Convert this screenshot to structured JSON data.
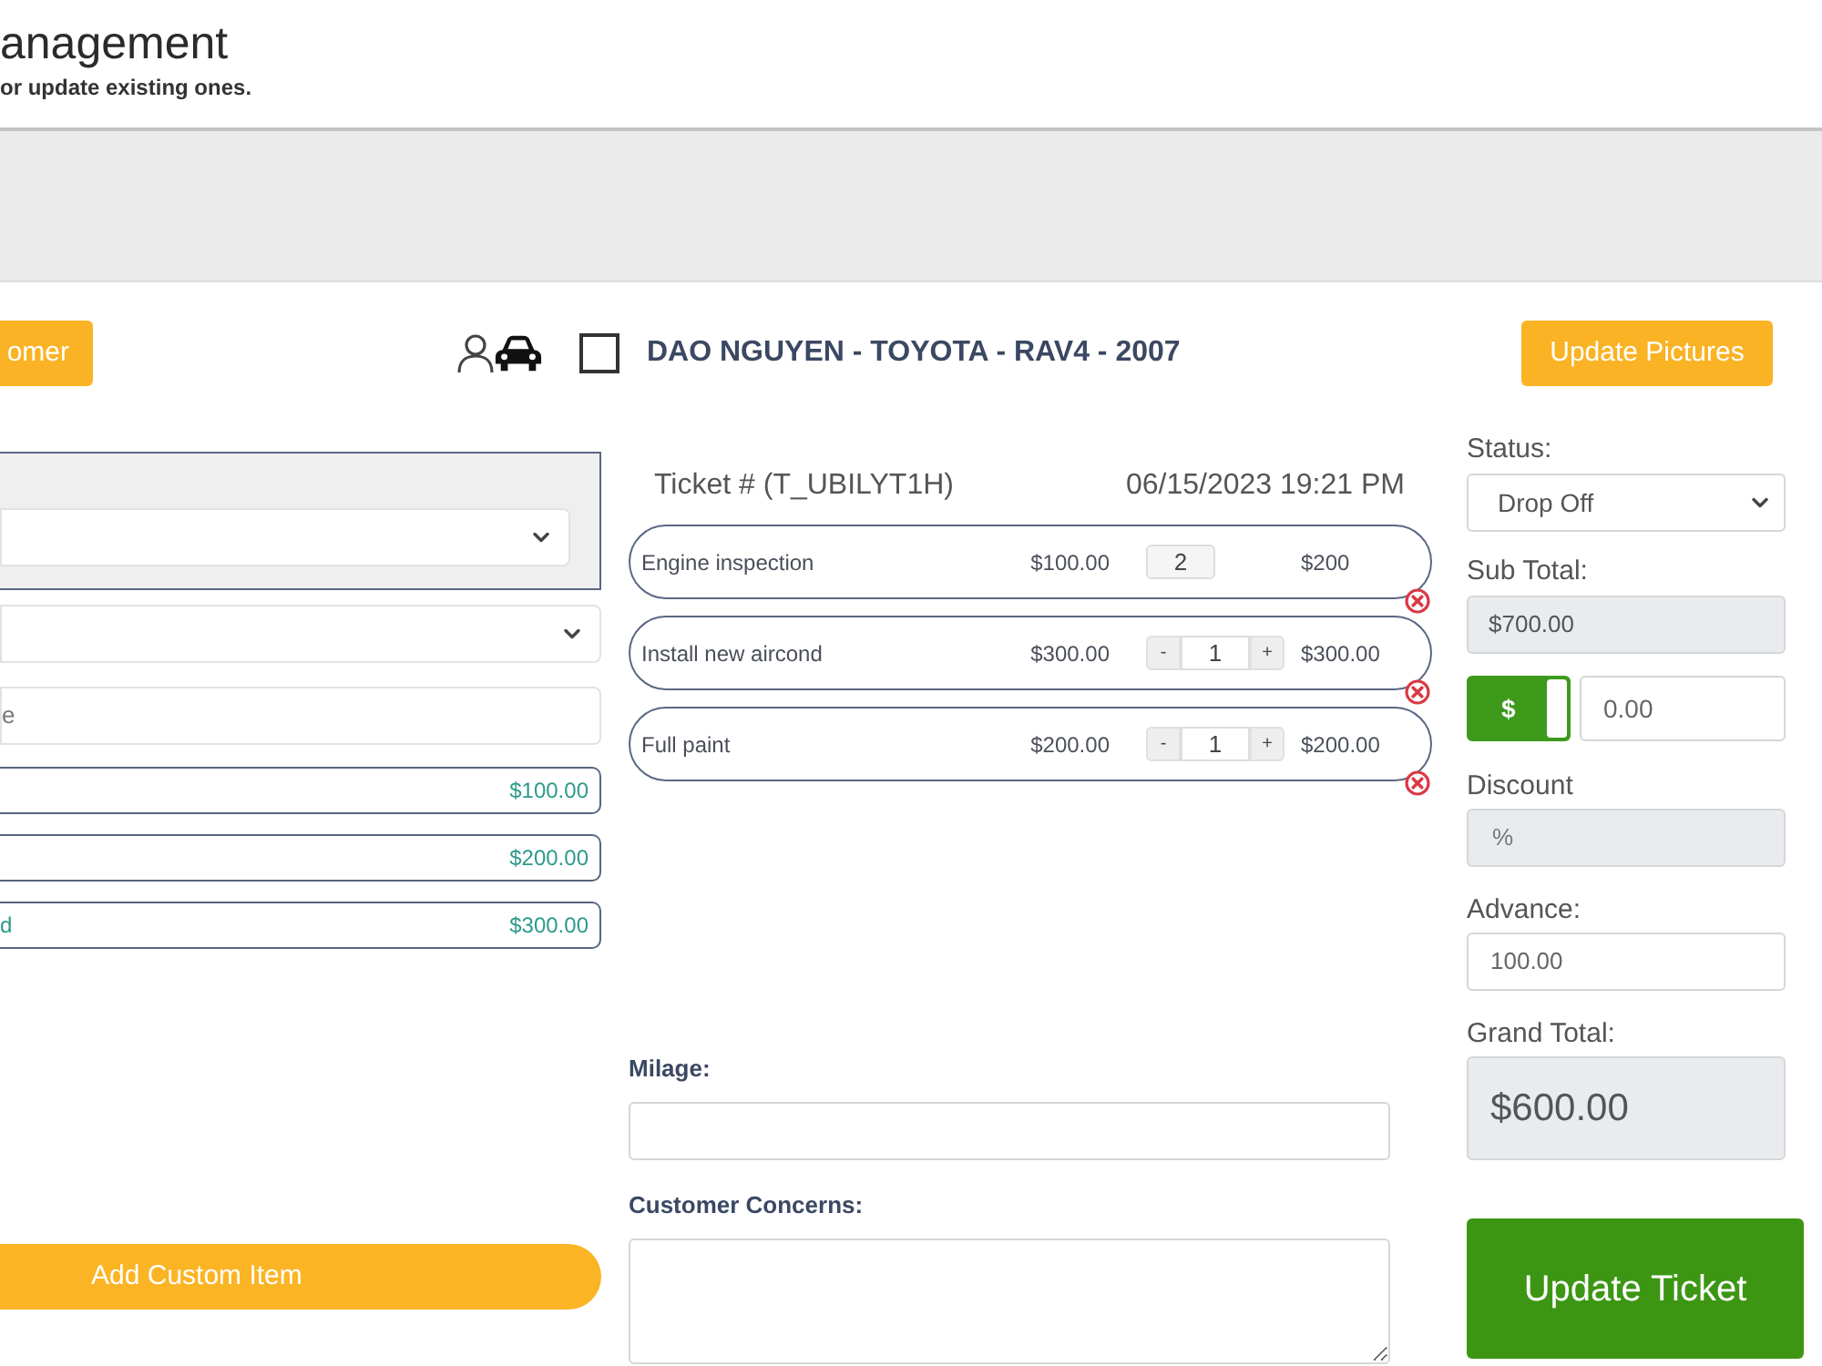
{
  "header": {
    "title": "anagement",
    "subtitle": "or update existing ones."
  },
  "toolbar": {
    "customer_button": "omer",
    "checkbox": {
      "checked": false
    },
    "vehicle_title": "DAO NGUYEN - TOYOTA - RAV4 - 2007",
    "pictures_button": "Update Pictures"
  },
  "search": {
    "placeholder": "e"
  },
  "services": [
    {
      "price": "$100.00"
    },
    {
      "price": "$200.00"
    },
    {
      "name": "d",
      "price": "$300.00"
    }
  ],
  "add_button": "Add Custom Item",
  "ticket": {
    "number": "Ticket # (T_UBILYT1H)",
    "date": "06/15/2023 19:21 PM",
    "items": [
      {
        "kind": "fixed",
        "name": "Engine inspection",
        "price": "$100.00",
        "quantity": "2",
        "total": "$200"
      },
      {
        "kind": "stepper",
        "name": "Install new aircond",
        "price": "$300.00",
        "decrement": "-",
        "quantity": "1",
        "increment": "+",
        "total": "$300.00"
      },
      {
        "kind": "stepper",
        "name": "Full paint",
        "price": "$200.00",
        "decrement": "-",
        "quantity": "1",
        "increment": "+",
        "total": "$200.00"
      }
    ]
  },
  "milage": {
    "label": "Milage:"
  },
  "concerns": {
    "label": "Customer Concerns:"
  },
  "summary": {
    "status": {
      "label": "Status:",
      "value": "Drop Off"
    },
    "subtotal": {
      "label": "Sub Total:",
      "value": "$700.00"
    },
    "discount_mode": {
      "symbol": "$",
      "on": true
    },
    "discount_amount": "0.00",
    "discount": {
      "label": "Discount",
      "value": "%"
    },
    "advance": {
      "label": "Advance:",
      "value": "100.00"
    },
    "grand_total": {
      "label": "Grand Total:",
      "value": "$600.00"
    },
    "update_button": "Update Ticket"
  }
}
